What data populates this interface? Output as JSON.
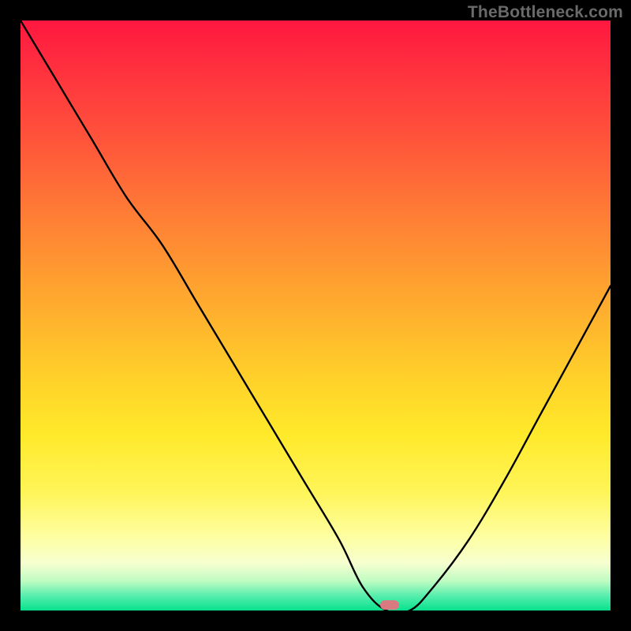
{
  "watermark": "TheBottleneck.com",
  "marker": {
    "x_pct": 62.5,
    "y_pct": 99.0,
    "color": "#d87a80"
  },
  "chart_data": {
    "type": "line",
    "title": "",
    "xlabel": "",
    "ylabel": "",
    "xlim": [
      0,
      100
    ],
    "ylim": [
      0,
      100
    ],
    "grid": false,
    "legend": false,
    "series": [
      {
        "name": "bottleneck-curve",
        "x": [
          0,
          6,
          12,
          18,
          24,
          30,
          36,
          42,
          48,
          54,
          58,
          62,
          66,
          70,
          76,
          82,
          88,
          94,
          100
        ],
        "y": [
          100,
          90,
          80,
          70,
          62,
          52,
          42,
          32,
          22,
          12,
          4,
          0,
          0,
          4,
          12,
          22,
          33,
          44,
          55
        ]
      }
    ],
    "annotations": [
      {
        "text": "TheBottleneck.com",
        "position": "top-right"
      }
    ],
    "background_gradient": {
      "stops": [
        {
          "pct": 0,
          "color": "#ff173f"
        },
        {
          "pct": 18,
          "color": "#ff4d3b"
        },
        {
          "pct": 46,
          "color": "#ffa52f"
        },
        {
          "pct": 70,
          "color": "#ffe92a"
        },
        {
          "pct": 88,
          "color": "#fdffa6"
        },
        {
          "pct": 97,
          "color": "#57eead"
        },
        {
          "pct": 100,
          "color": "#08e18e"
        }
      ]
    }
  }
}
